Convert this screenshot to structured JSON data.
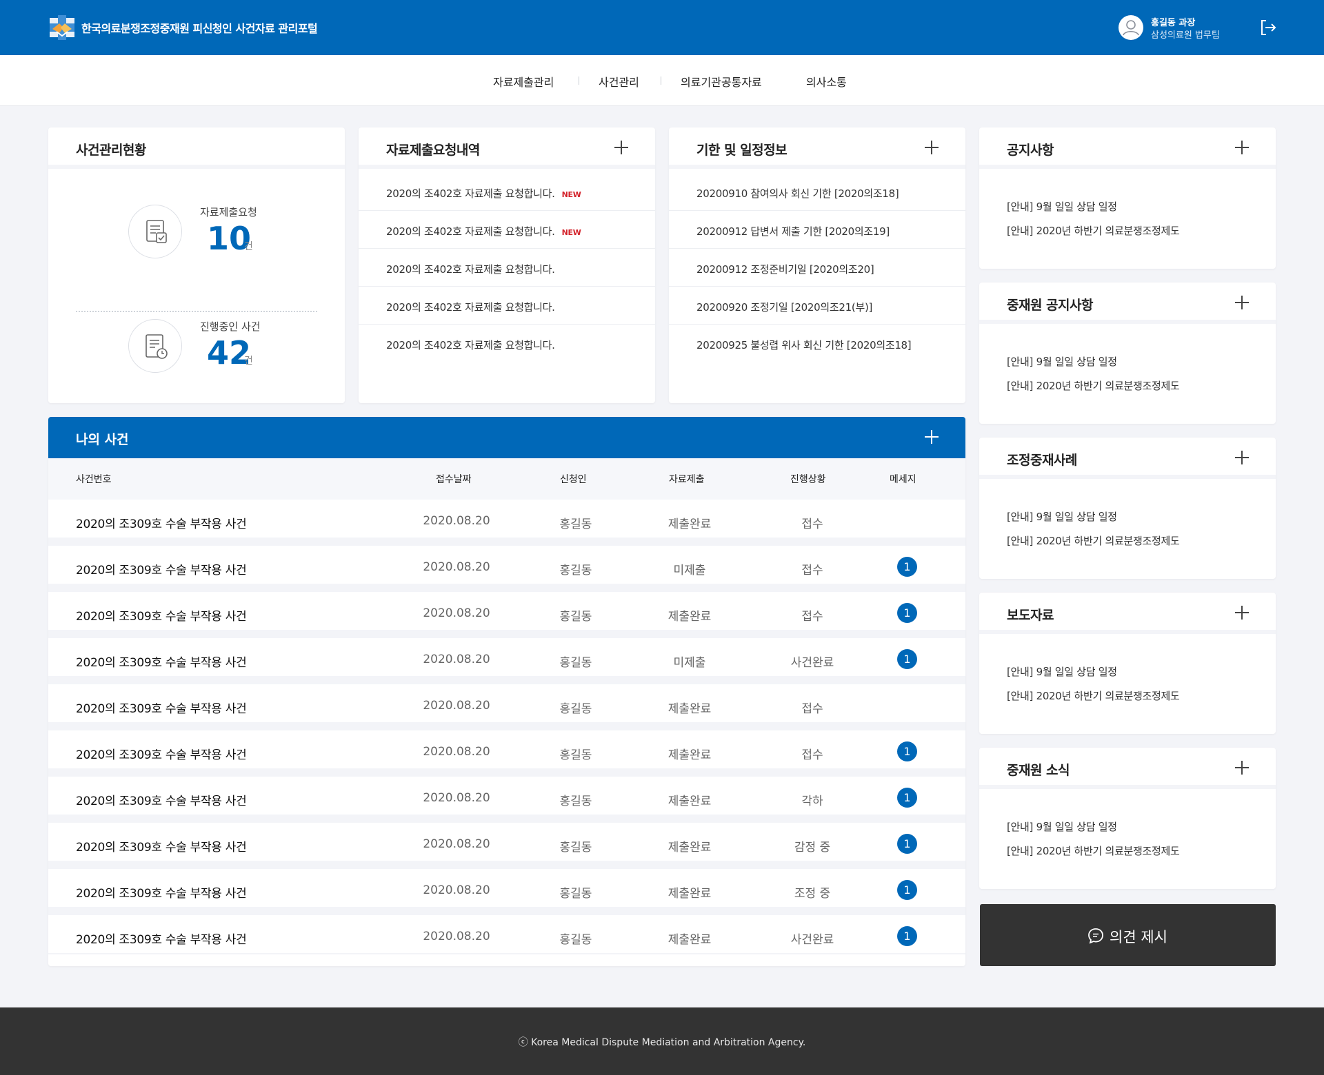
{
  "header": {
    "site_title": "한국의료분쟁조정중재원 피신청인 사건자료 관리포털",
    "user_name": "홍길동 과장",
    "user_org": "삼성의료원 법무팀"
  },
  "nav": [
    "자료제출관리",
    "사건관리",
    "의료기관공통자료",
    "의사소통"
  ],
  "case_status": {
    "title": "사건관리현황",
    "items": [
      {
        "label": "자료제출요청",
        "value": "10",
        "unit": "건"
      },
      {
        "label": "진행중인 사건",
        "value": "42",
        "unit": "건"
      }
    ]
  },
  "requests": {
    "title": "자료제출요청내역",
    "new_label": "NEW",
    "items": [
      "2020의 조402호 자료제출 요청합니다.",
      "2020의 조402호 자료제출 요청합니다.",
      "2020의 조402호 자료제출 요청합니다.",
      "2020의 조402호 자료제출 요청합니다.",
      "2020의 조402호 자료제출 요청합니다."
    ]
  },
  "schedule": {
    "title": "기한 및 일정정보",
    "items": [
      "20200910 참여의사 회신 기한 [2020의조18]",
      "20200912 답변서 제출 기한 [2020의조19]",
      "20200912 조정준비기일 [2020의조20]",
      "20200920 조정기일 [2020의조21(부)]",
      "20200925 불성렵 위사 회신 기한 [2020의조18]"
    ]
  },
  "side_panels": [
    {
      "title": "공지사항",
      "items": [
        "[안내] 9월 일일 상담 일정",
        "[안내] 2020년 하반기 의료분쟁조정제도"
      ]
    },
    {
      "title": "중재원 공지사항",
      "items": [
        "[안내] 9월 일일 상담 일정",
        "[안내] 2020년 하반기 의료분쟁조정제도"
      ]
    },
    {
      "title": "조정중재사례",
      "items": [
        "[안내] 9월 일일 상담 일정",
        "[안내] 2020년 하반기 의료분쟁조정제도"
      ]
    },
    {
      "title": "보도자료",
      "items": [
        "[안내] 9월 일일 상담 일정",
        "[안내] 2020년 하반기 의료분쟁조정제도"
      ]
    },
    {
      "title": "중재원 소식",
      "items": [
        "[안내] 9월 일일 상담 일정",
        "[안내] 2020년 하반기 의료분쟁조정제도"
      ]
    }
  ],
  "my_cases": {
    "title": "나의 사건",
    "columns": [
      "사건번호",
      "접수날짜",
      "신청인",
      "자료제출",
      "진행상황",
      "메세지"
    ],
    "rows": [
      {
        "case_no": "2020의 조309호 수술 부작용 사건",
        "date": "2020.08.20",
        "applicant": "홍길동",
        "submission": "제출완료",
        "status": "접수",
        "message": ""
      },
      {
        "case_no": "2020의 조309호 수술 부작용 사건",
        "date": "2020.08.20",
        "applicant": "홍길동",
        "submission": "미제출",
        "status": "접수",
        "message": "1"
      },
      {
        "case_no": "2020의 조309호 수술 부작용 사건",
        "date": "2020.08.20",
        "applicant": "홍길동",
        "submission": "제출완료",
        "status": "접수",
        "message": "1"
      },
      {
        "case_no": "2020의 조309호 수술 부작용 사건",
        "date": "2020.08.20",
        "applicant": "홍길동",
        "submission": "미제출",
        "status": "사건완료",
        "message": "1"
      },
      {
        "case_no": "2020의 조309호 수술 부작용 사건",
        "date": "2020.08.20",
        "applicant": "홍길동",
        "submission": "제출완료",
        "status": "접수",
        "message": ""
      },
      {
        "case_no": "2020의 조309호 수술 부작용 사건",
        "date": "2020.08.20",
        "applicant": "홍길동",
        "submission": "제출완료",
        "status": "접수",
        "message": "1"
      },
      {
        "case_no": "2020의 조309호 수술 부작용 사건",
        "date": "2020.08.20",
        "applicant": "홍길동",
        "submission": "제출완료",
        "status": "각하",
        "message": "1"
      },
      {
        "case_no": "2020의 조309호 수술 부작용 사건",
        "date": "2020.08.20",
        "applicant": "홍길동",
        "submission": "제출완료",
        "status": "감정 중",
        "message": "1"
      },
      {
        "case_no": "2020의 조309호 수술 부작용 사건",
        "date": "2020.08.20",
        "applicant": "홍길동",
        "submission": "제출완료",
        "status": "조정 중",
        "message": "1"
      },
      {
        "case_no": "2020의 조309호 수술 부작용 사건",
        "date": "2020.08.20",
        "applicant": "홍길동",
        "submission": "제출완료",
        "status": "사건완료",
        "message": "1"
      }
    ]
  },
  "opinion_button": {
    "label": "의견 제시"
  },
  "footer": {
    "copyright": "ⓒ Korea Medical Dispute Mediation and Arbitration Agency."
  },
  "colors": {
    "primary": "#0068b8",
    "dark": "#333333",
    "new_red": "#d3222a",
    "background": "#f3f4f8"
  },
  "icons": [
    "logo-icon",
    "avatar-icon",
    "logout-icon",
    "plus-icon",
    "document-check-icon",
    "document-clock-icon",
    "chat-bubble-icon"
  ]
}
